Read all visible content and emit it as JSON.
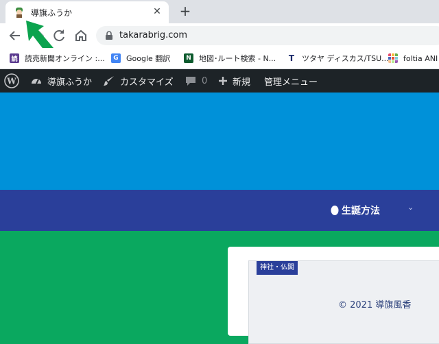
{
  "browser": {
    "tab": {
      "title": "導旗ふうか"
    },
    "url": "takarabrig.com",
    "bookmarks": [
      {
        "label": "読売新聞オンライン :...",
        "icon": "yomiuri-icon"
      },
      {
        "label": "Google 翻訳",
        "icon": "google-translate-icon"
      },
      {
        "label": "地図･ルート検索 - N...",
        "icon": "navitime-icon"
      },
      {
        "label": "ツタヤ ディスカス/TSU...",
        "icon": "tsutaya-icon"
      },
      {
        "label": "foltia ANI",
        "icon": "foltia-icon"
      }
    ]
  },
  "admin_bar": {
    "site_name": "導旗ふうか",
    "customize": "カスタマイズ",
    "comments_count": "0",
    "new_label": "新規",
    "admin_menu": "管理メニュー"
  },
  "site": {
    "nav_item": "生誕方法",
    "category": "神社・仏閣",
    "copyright": "© 2021 導旗風香"
  },
  "colors": {
    "hero": "#0091d9",
    "nav": "#2a3f9a",
    "background": "#0aa85f",
    "admin_bar": "#1d2327"
  }
}
